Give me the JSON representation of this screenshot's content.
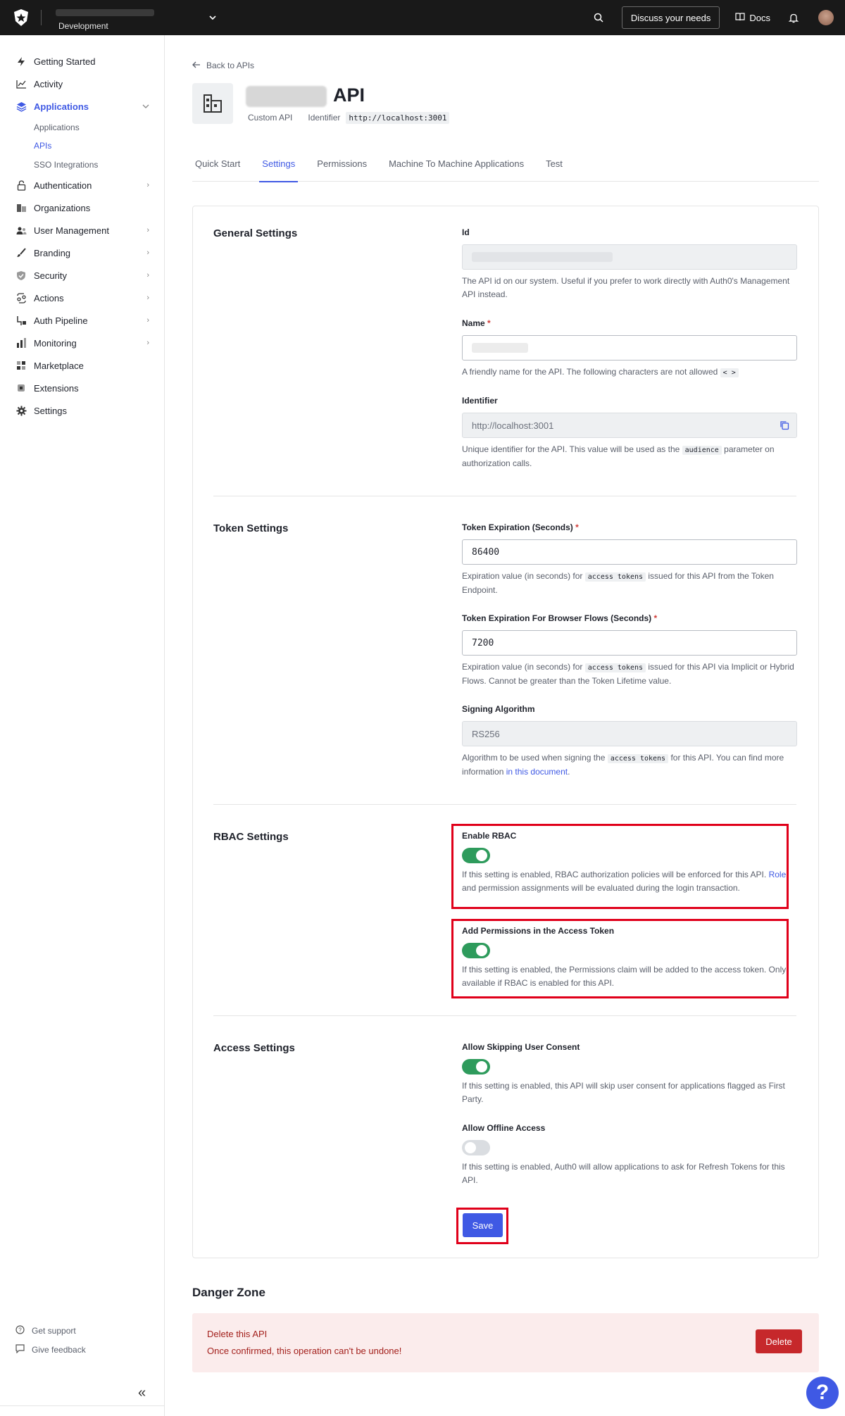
{
  "topbar": {
    "environment": "Development",
    "discuss_label": "Discuss your needs",
    "docs_label": "Docs"
  },
  "sidebar": {
    "items": [
      {
        "label": "Getting Started"
      },
      {
        "label": "Activity"
      },
      {
        "label": "Applications"
      },
      {
        "label": "Authentication"
      },
      {
        "label": "Organizations"
      },
      {
        "label": "User Management"
      },
      {
        "label": "Branding"
      },
      {
        "label": "Security"
      },
      {
        "label": "Actions"
      },
      {
        "label": "Auth Pipeline"
      },
      {
        "label": "Monitoring"
      },
      {
        "label": "Marketplace"
      },
      {
        "label": "Extensions"
      },
      {
        "label": "Settings"
      }
    ],
    "sub_items": [
      {
        "label": "Applications"
      },
      {
        "label": "APIs"
      },
      {
        "label": "SSO Integrations"
      }
    ],
    "get_support": "Get support",
    "give_feedback": "Give feedback"
  },
  "header": {
    "back_label": "Back to APIs",
    "title": "API",
    "type": "Custom API",
    "identifier_label": "Identifier",
    "identifier_value": "http://localhost:3001"
  },
  "tabs": [
    {
      "label": "Quick Start"
    },
    {
      "label": "Settings"
    },
    {
      "label": "Permissions"
    },
    {
      "label": "Machine To Machine Applications"
    },
    {
      "label": "Test"
    }
  ],
  "general": {
    "title": "General Settings",
    "id_label": "Id",
    "id_help": "The API id on our system. Useful if you prefer to work directly with Auth0's Management API instead.",
    "name_label": "Name",
    "name_help": "A friendly name for the API. The following characters are not allowed",
    "name_chars": "< >",
    "identifier_label": "Identifier",
    "identifier_value": "http://localhost:3001",
    "identifier_help_1": "Unique identifier for the API. This value will be used as the",
    "identifier_help_chip": "audience",
    "identifier_help_2": "parameter on authorization calls."
  },
  "token": {
    "title": "Token Settings",
    "exp_label": "Token Expiration (Seconds)",
    "exp_value": "86400",
    "exp_help_1": "Expiration value (in seconds) for",
    "exp_help_chip": "access tokens",
    "exp_help_2": "issued for this API from the Token Endpoint.",
    "browser_label": "Token Expiration For Browser Flows (Seconds)",
    "browser_value": "7200",
    "browser_help_1": "Expiration value (in seconds) for",
    "browser_help_chip": "access tokens",
    "browser_help_2": "issued for this API via Implicit or Hybrid Flows. Cannot be greater than the Token Lifetime value.",
    "alg_label": "Signing Algorithm",
    "alg_value": "RS256",
    "alg_help_1": "Algorithm to be used when signing the",
    "alg_help_chip": "access tokens",
    "alg_help_2": "for this API. You can find more information",
    "alg_help_link": "in this document",
    "alg_help_end": "."
  },
  "rbac": {
    "title": "RBAC Settings",
    "enable_label": "Enable RBAC",
    "enable_on": true,
    "enable_help_1": "If this setting is enabled, RBAC authorization policies will be enforced for this API.",
    "enable_help_link": "Role",
    "enable_help_2": "and permission assignments will be evaluated during the login transaction.",
    "perm_label": "Add Permissions in the Access Token",
    "perm_on": true,
    "perm_help": "If this setting is enabled, the Permissions claim will be added to the access token. Only available if RBAC is enabled for this API."
  },
  "access": {
    "title": "Access Settings",
    "skip_label": "Allow Skipping User Consent",
    "skip_on": true,
    "skip_help": "If this setting is enabled, this API will skip user consent for applications flagged as First Party.",
    "offline_label": "Allow Offline Access",
    "offline_on": false,
    "offline_help": "If this setting is enabled, Auth0 will allow applications to ask for Refresh Tokens for this API.",
    "save_label": "Save"
  },
  "danger": {
    "title": "Danger Zone",
    "delete_title": "Delete this API",
    "delete_warning": "Once confirmed, this operation can't be undone!",
    "delete_label": "Delete"
  },
  "help_fab": "?",
  "colors": {
    "accent": "#3f59e4",
    "toggle_on": "#2e9b5c",
    "danger": "#c6282b",
    "highlight": "#e0001a"
  }
}
